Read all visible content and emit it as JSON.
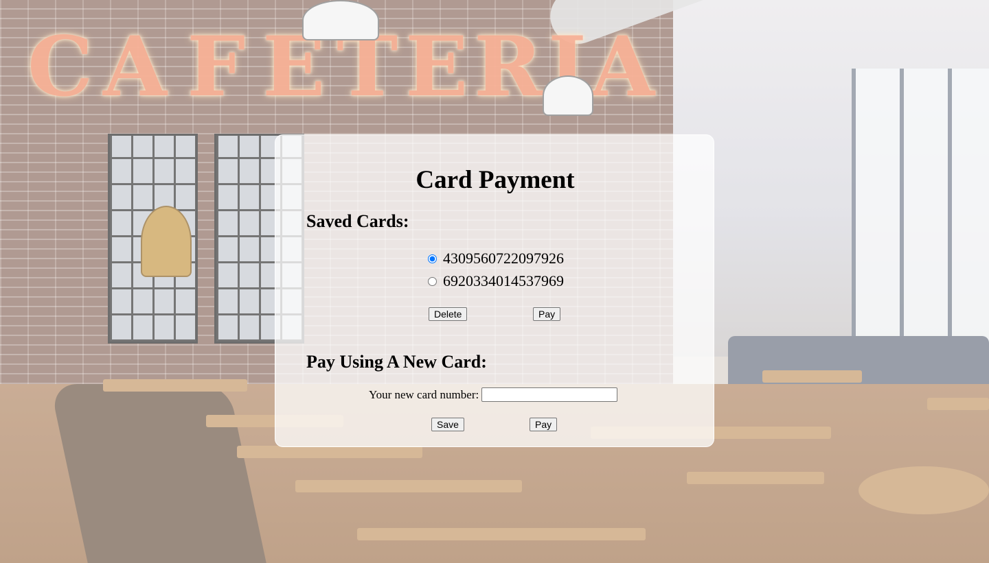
{
  "background": {
    "sign_letters": [
      "C",
      "A",
      "F",
      "E",
      "T",
      "E",
      "R",
      "I",
      "A"
    ]
  },
  "panel": {
    "title": "Card Payment",
    "saved_cards": {
      "heading": "Saved Cards:",
      "cards": [
        {
          "number": "4309560722097926",
          "selected": true
        },
        {
          "number": "6920334014537969",
          "selected": false
        }
      ],
      "delete_label": "Delete",
      "pay_label": "Pay"
    },
    "new_card": {
      "heading": "Pay Using A New Card:",
      "field_label": "Your new card number:",
      "field_value": "",
      "save_label": "Save",
      "pay_label": "Pay"
    }
  },
  "colors": {
    "panel_background": "#ffffffbd",
    "radio_accent": "#1a73e8"
  }
}
